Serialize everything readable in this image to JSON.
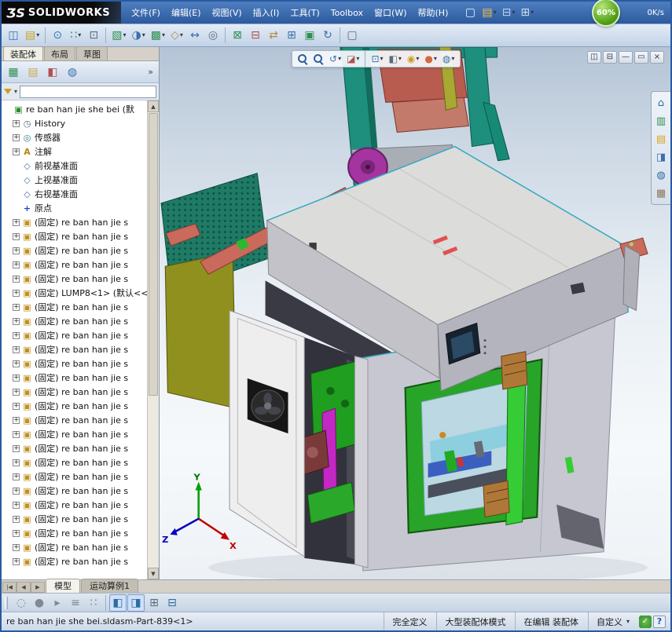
{
  "titlebar": {
    "logo_mark": "ƷS",
    "logo_text": "SOLIDWORKS",
    "ball": "60%",
    "speed": "0K/s",
    "icons": [
      {
        "name": "new-document-icon",
        "glyph": "▢",
        "color": "#eef4fb"
      },
      {
        "name": "open-icon",
        "glyph": "▤",
        "color": "#f0c24a",
        "dd": true
      },
      {
        "name": "save-icon",
        "glyph": "⊟",
        "color": "#bcd2ec",
        "dd": true
      },
      {
        "name": "print-icon",
        "glyph": "⊞",
        "color": "#cddcec",
        "dd": true
      }
    ]
  },
  "menu": {
    "items": [
      "文件(F)",
      "编辑(E)",
      "视图(V)",
      "插入(I)",
      "工具(T)",
      "Toolbox",
      "窗口(W)",
      "帮助(H)"
    ]
  },
  "toolbar": {
    "icons": [
      {
        "name": "featuremanager-display-icon",
        "glyph": "◫",
        "color": "#3b6fae"
      },
      {
        "name": "open-part-icon",
        "glyph": "▤",
        "color": "#caa21f",
        "dd": true
      },
      {
        "sep": true
      },
      {
        "name": "mate-icon",
        "glyph": "⊙",
        "color": "#2f7fb0"
      },
      {
        "name": "linear-pattern-icon",
        "glyph": "∷",
        "color": "#2f8f4f",
        "dd": true
      },
      {
        "name": "smart-fasteners-icon",
        "glyph": "⊡",
        "color": "#5a6b7c"
      },
      {
        "sep": true
      },
      {
        "name": "insert-component-icon",
        "glyph": "▧",
        "color": "#2f8f4f",
        "dd": true
      },
      {
        "name": "hide-show-components-icon",
        "glyph": "◑",
        "color": "#3b6fae",
        "dd": true
      },
      {
        "name": "assembly-features-icon",
        "glyph": "▩",
        "color": "#2f8f4f",
        "dd": true
      },
      {
        "name": "reference-geometry-icon",
        "glyph": "◇",
        "color": "#b5884a",
        "dd": true
      },
      {
        "name": "move-component-icon",
        "glyph": "↔",
        "color": "#3b6fae"
      },
      {
        "name": "show-hidden-components-icon",
        "glyph": "◎",
        "color": "#5a6b7c"
      },
      {
        "sep": true
      },
      {
        "name": "exploded-view-icon",
        "glyph": "⊠",
        "color": "#2f8f4f"
      },
      {
        "name": "interference-detection-icon",
        "glyph": "⊟",
        "color": "#b05050"
      },
      {
        "name": "measure-icon",
        "glyph": "⇄",
        "color": "#b5884a"
      },
      {
        "name": "mass-properties-icon",
        "glyph": "⊞",
        "color": "#3b6fae"
      },
      {
        "name": "simulation-icon",
        "glyph": "▣",
        "color": "#2f8f4f"
      },
      {
        "name": "motion-study-icon",
        "glyph": "↻",
        "color": "#3b6fae"
      },
      {
        "sep": true
      },
      {
        "name": "screen-capture-icon",
        "glyph": "▢",
        "color": "#5a6b7c"
      }
    ]
  },
  "panel": {
    "tabs": [
      "装配体",
      "布局",
      "草图"
    ],
    "active_tab": 0,
    "more_label": "»",
    "filter_dd": "▾",
    "filter_placeholder": "",
    "tools": [
      {
        "name": "featuremanager-tree-icon",
        "glyph": "▦",
        "color": "#2f8f4f"
      },
      {
        "name": "propertymanager-icon",
        "glyph": "▤",
        "color": "#c8a84a"
      },
      {
        "name": "configurationmanager-icon",
        "glyph": "◧",
        "color": "#b05050"
      },
      {
        "name": "displaymanager-icon",
        "glyph": "◍",
        "color": "#3b6fae"
      }
    ]
  },
  "icons": {
    "assembly": {
      "glyph": "▣",
      "color": "#2e8b2e"
    },
    "history": {
      "glyph": "◷",
      "color": "#5a6b7c"
    },
    "sensor": {
      "glyph": "◎",
      "color": "#2e7d8f"
    },
    "annotation": {
      "glyph": "A",
      "color": "#b8860b"
    },
    "plane": {
      "glyph": "◇",
      "color": "#4a6fa5"
    },
    "origin": {
      "glyph": "+",
      "color": "#2244cc"
    },
    "part": {
      "glyph": "▣",
      "color": "#c09020"
    }
  },
  "tree": {
    "root_label": "re ban han jie she bei (默",
    "special": [
      {
        "icon": "history",
        "label": "History",
        "exp": "+"
      },
      {
        "icon": "sensor",
        "label": "传感器",
        "exp": "+"
      },
      {
        "icon": "annotation",
        "label": "注解",
        "exp": "+"
      },
      {
        "icon": "plane",
        "label": "前视基准面"
      },
      {
        "icon": "plane",
        "label": "上视基准面"
      },
      {
        "icon": "plane",
        "label": "右视基准面"
      },
      {
        "icon": "origin",
        "label": "原点"
      }
    ],
    "fixed_label": "(固定) re ban han jie s",
    "lump_label": "(固定) LUMP8<1> (默认<<",
    "fixed_before": 5,
    "fixed_after": 19
  },
  "viewport": {
    "hud_icons": [
      {
        "name": "zoom-fit-icon",
        "mag": true
      },
      {
        "name": "zoom-area-icon",
        "mag": true
      },
      {
        "name": "previous-view-icon",
        "glyph": "↺",
        "color": "#3b6fae",
        "dd": true
      },
      {
        "name": "section-view-icon",
        "glyph": "◪",
        "color": "#b05050",
        "dd": true
      },
      {
        "sep": true
      },
      {
        "name": "view-orientation-icon",
        "glyph": "⊡",
        "color": "#3b6fae",
        "dd": true
      },
      {
        "name": "display-style-icon",
        "glyph": "◧",
        "color": "#5a6b7c",
        "dd": true
      },
      {
        "name": "hide-show-items-icon",
        "glyph": "◉",
        "color": "#c8a020",
        "dd": true
      },
      {
        "name": "edit-appearance-icon",
        "glyph": "●",
        "color": "#d4683a",
        "dd": true
      },
      {
        "name": "apply-scene-icon",
        "glyph": "◍",
        "color": "#3b6fae",
        "dd": true
      }
    ],
    "doc_controls": [
      {
        "name": "window-split-icon",
        "glyph": "◫"
      },
      {
        "name": "window-cascade-icon",
        "glyph": "⊟"
      },
      {
        "name": "window-minimize-icon",
        "glyph": "—"
      },
      {
        "name": "window-restore-icon",
        "glyph": "▭"
      },
      {
        "name": "window-close-icon",
        "glyph": "×"
      }
    ]
  },
  "task_pane": {
    "icons": [
      {
        "name": "solidworks-resources-icon",
        "glyph": "⌂",
        "color": "#2e6da4"
      },
      {
        "name": "design-library-icon",
        "glyph": "▥",
        "color": "#2f8f4f"
      },
      {
        "name": "file-explorer-icon",
        "glyph": "▤",
        "color": "#d9a520"
      },
      {
        "name": "view-palette-icon",
        "glyph": "◨",
        "color": "#3b6fae"
      },
      {
        "name": "appearances-icon",
        "glyph": "◍",
        "color": "#2e6da4"
      },
      {
        "name": "custom-properties-icon",
        "glyph": "▦",
        "color": "#8a7a5a"
      }
    ]
  },
  "bottom_tabs": {
    "nav": [
      "|◀",
      "◀",
      "▶"
    ],
    "tabs": [
      "模型",
      "运动算例1"
    ],
    "active": 0
  },
  "macro_bar": {
    "icons": [
      {
        "name": "record-pause-icon",
        "glyph": "◌",
        "color": "#808890"
      },
      {
        "name": "record-macro-icon",
        "glyph": "●",
        "color": "#808890"
      },
      {
        "name": "run-macro-icon",
        "glyph": "▸",
        "color": "#808890"
      },
      {
        "name": "edit-macro-icon",
        "glyph": "≡",
        "color": "#808890"
      },
      {
        "name": "new-macro-icon",
        "glyph": "∷",
        "color": "#808890"
      },
      {
        "sep": true
      },
      {
        "name": "solidworks-search-icon",
        "glyph": "◧",
        "color": "#2e6da4",
        "pressed": true
      },
      {
        "name": "knowledge-base-icon",
        "glyph": "◨",
        "color": "#2e6da4",
        "pressed": true
      },
      {
        "name": "bom-table-icon",
        "glyph": "⊞",
        "color": "#5a6b7c"
      },
      {
        "name": "save-table-icon",
        "glyph": "⊟",
        "color": "#2e6da4"
      }
    ]
  },
  "status": {
    "left": "re ban han jie she bei.sldasm-Part-839<1>",
    "definition": "完全定义",
    "mode": "大型装配体模式",
    "editing": "在编辑 装配体",
    "custom": "自定义",
    "custom_dd": "▾",
    "check_glyph": "✓",
    "help_glyph": "?"
  }
}
